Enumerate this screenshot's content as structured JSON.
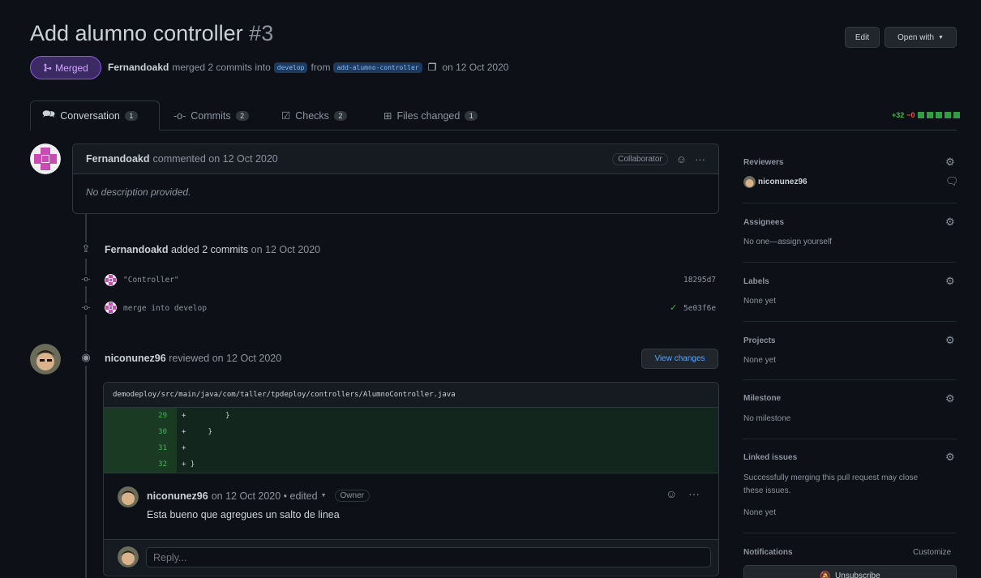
{
  "header": {
    "title": "Add alumno controller",
    "number": "#3",
    "edit_label": "Edit",
    "open_with_label": "Open with"
  },
  "status": {
    "badge": "Merged",
    "author": "Fernandoakd",
    "action": "merged 2 commits into",
    "base_branch": "develop",
    "from_word": "from",
    "head_branch": "add-alumno-controller",
    "date": "on 12 Oct 2020"
  },
  "tabs": [
    {
      "label": "Conversation",
      "count": "1"
    },
    {
      "label": "Commits",
      "count": "2"
    },
    {
      "label": "Checks",
      "count": "2"
    },
    {
      "label": "Files changed",
      "count": "1"
    }
  ],
  "diffstat": {
    "added": "+32",
    "removed": "−0"
  },
  "first_comment": {
    "author": "Fernandoakd",
    "action": "commented on 12 Oct 2020",
    "role": "Collaborator",
    "body": "No description provided."
  },
  "commits_event": {
    "author": "Fernandoakd",
    "action": "added 2 commits",
    "date": "on 12 Oct 2020",
    "commits": [
      {
        "message": "\"Controller\"",
        "sha": "18295d7"
      },
      {
        "message": "merge into develop",
        "sha": "5e03f6e"
      }
    ]
  },
  "review": {
    "author": "niconunez96",
    "action": "reviewed on 12 Oct 2020",
    "view_changes_label": "View changes",
    "file_path": "demodeploy/src/main/java/com/taller/tpdeploy/controllers/AlumnoController.java",
    "lines": [
      {
        "num": "29",
        "text": "+         }"
      },
      {
        "num": "30",
        "text": "+     }"
      },
      {
        "num": "31",
        "text": "+"
      },
      {
        "num": "32",
        "text": "+ }"
      }
    ],
    "comment_author": "niconunez96",
    "comment_meta": "on 12 Oct 2020 • edited",
    "comment_role": "Owner",
    "comment_body": "Esta bueno que agregues un salto de linea",
    "reply_placeholder": "Reply..."
  },
  "sidebar": {
    "reviewers_label": "Reviewers",
    "reviewer_name": "niconunez96",
    "assignees_label": "Assignees",
    "assignees_value": "No one—assign yourself",
    "labels_label": "Labels",
    "labels_value": "None yet",
    "projects_label": "Projects",
    "projects_value": "None yet",
    "milestone_label": "Milestone",
    "milestone_value": "No milestone",
    "linked_label": "Linked issues",
    "linked_desc_1": "Successfully merging this pull request may close",
    "linked_desc_2": "these issues.",
    "linked_value": "None yet",
    "notifications_label": "Notifications",
    "customize_label": "Customize",
    "unsubscribe_label": "Unsubscribe"
  }
}
